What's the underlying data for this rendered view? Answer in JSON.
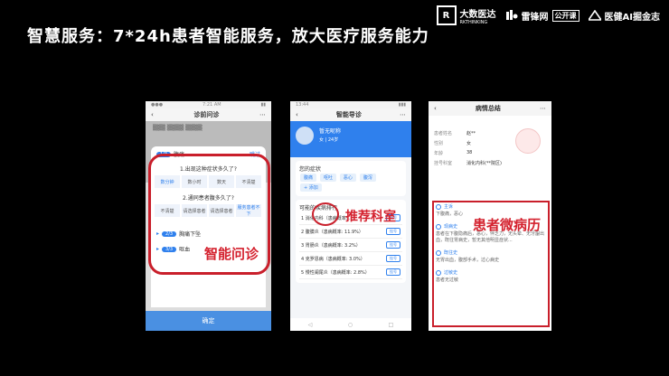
{
  "slide": {
    "title": "智慧服务：7*24h患者智能服务，放大医疗服务能力",
    "logos": {
      "rk_mark": "R",
      "rk_name": "大数医达",
      "rk_sub": "RKTHINKING",
      "leifeng": "雷锋网",
      "leifeng_badge": "公开课",
      "yijian": "医健AI掘金志"
    }
  },
  "phone1": {
    "nav_title": "诊前问诊",
    "step1": "1/3",
    "symptom": "腹痛",
    "skip": "跳过",
    "q1": "1.出现这种症状多久了?",
    "q1_options": [
      "数分钟",
      "数小时",
      "数天",
      "不清楚"
    ],
    "q2": "2.通同患者腹多久了?",
    "q2_options": [
      "不清楚",
      "请选择患者",
      "请选择患者",
      "服务患者不下"
    ],
    "step2": "2/3",
    "item2": "胸痛下坠",
    "step3": "3/3",
    "item3": "呕血",
    "confirm": "确定",
    "overlay_label": "智能问诊"
  },
  "phone2": {
    "nav_title": "智能导诊",
    "user_name": "暂无昵称",
    "user_tag": "女 | 24岁",
    "symptom_title": "您的症状",
    "chips": [
      "腹痛",
      "呕吐",
      "恶心",
      "腹泻"
    ],
    "chip_more": "+ 添加",
    "rank_title": "可能的疾病排行",
    "depts": [
      {
        "name": "1  消化内科（患病概率: ...）",
        "btn": "挂号"
      },
      {
        "name": "2  腹膜炎（患病概率: 11.9%）",
        "btn": "挂号"
      },
      {
        "name": "3  胃肠炎（患病概率: 3.2%）",
        "btn": "挂号"
      },
      {
        "name": "4  克罗恩病（患病概率: 3.0%）",
        "btn": "挂号"
      },
      {
        "name": "5  慢性阑尾炎（患病概率: 2.8%）",
        "btn": "挂号"
      }
    ],
    "overlay_label": "推荐科室"
  },
  "phone3": {
    "nav_title": "病情总结",
    "rows": [
      {
        "k": "患者姓名",
        "v": "赵**"
      },
      {
        "k": "性别",
        "v": "女"
      },
      {
        "k": "年龄",
        "v": "38"
      },
      {
        "k": "挂号科室",
        "v": "消化内科(**院区)"
      }
    ],
    "sections": [
      {
        "h": "主诉",
        "b": "下腹痛，恶心"
      },
      {
        "h": "现病史",
        "b": "患者在下腹隐痛后，恶心，伴乏力，无头晕、无牙龈出血，既往胃病史，暂无其他明显症状..."
      },
      {
        "h": "既往史",
        "b": "无胃出血，腹部手术，过心病史"
      },
      {
        "h": "过敏史",
        "b": "患者无过敏"
      }
    ],
    "overlay_label": "患者微病历"
  }
}
